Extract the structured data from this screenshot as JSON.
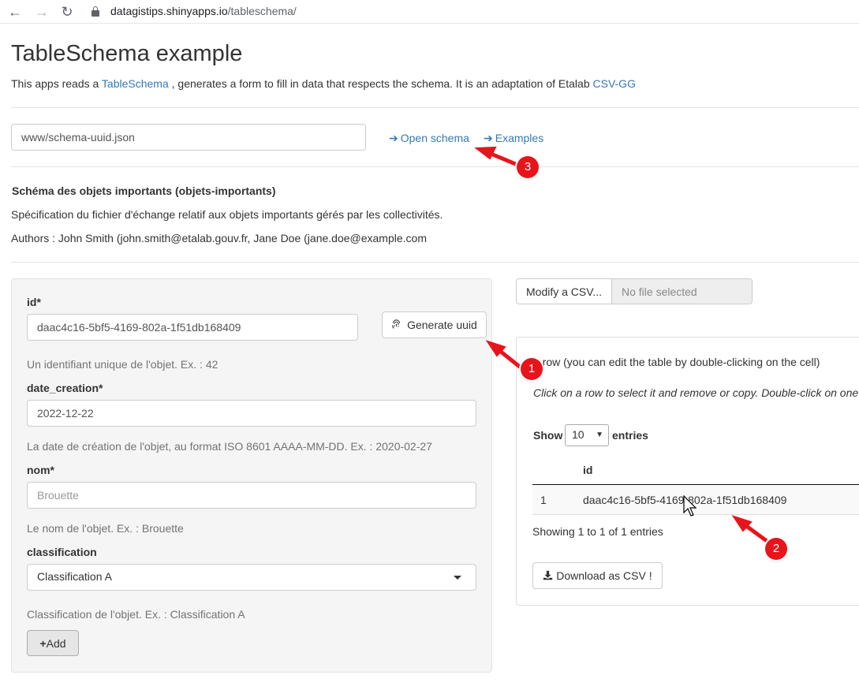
{
  "browser": {
    "url_host": "datagistips.shinyapps.io",
    "url_path": "/tableschema/"
  },
  "page": {
    "title": "TableSchema example",
    "intro_before": "This apps reads a ",
    "intro_link": "TableSchema",
    "intro_middle": " , generates a form to fill in data that respects the schema. It is an adaptation of Etalab ",
    "intro_link2": "CSV-GG"
  },
  "schema_picker": {
    "value": "www/schema-uuid.json",
    "open_label": "Open schema",
    "examples_label": "Examples"
  },
  "schema_info": {
    "title": "Schéma des objets importants (objets-importants)",
    "description": "Spécification du fichier d'échange relatif aux objets importants gérés par les collectivités.",
    "authors": "Authors : John Smith (john.smith@etalab.gouv.fr, Jane Doe (jane.doe@example.com"
  },
  "form": {
    "id_label": "id*",
    "id_value": "daac4c16-5bf5-4169-802a-1f51db168409",
    "generate_label": "Generate uuid",
    "id_help": "Un identifiant unique de l'objet. Ex. : 42",
    "date_label": "date_creation*",
    "date_value": "2022-12-22",
    "date_help": "La date de création de l'objet, au format ISO 8601 AAAA-MM-DD. Ex. : 2020-02-27",
    "nom_label": "nom*",
    "nom_placeholder": "Brouette",
    "nom_help": "Le nom de l'objet. Ex. : Brouette",
    "class_label": "classification",
    "class_value": "Classification A",
    "class_help": "Classification de l'objet. Ex. : Classification A",
    "add_label": "Add"
  },
  "file_input": {
    "button_label": "Modify a CSV...",
    "status": "No file selected"
  },
  "table_panel": {
    "row_count": "1",
    "row_info": " row (you can edit the table by double-clicking on the cell)",
    "instructions": "Click on a row to select it and remove or copy. Double-click on one",
    "show_label": "Show",
    "page_length": "10",
    "entries_label": "entries",
    "column_header": "id",
    "rows": [
      {
        "index": "1",
        "id": "daac4c16-5bf5-4169-802a-1f51db168409"
      }
    ],
    "footer": "Showing 1 to 1 of 1 entries",
    "download_label": "Download as CSV !"
  },
  "annotations": [
    "1",
    "2",
    "3"
  ],
  "colors": {
    "link": "#337ab7",
    "annotation": "#e8141c",
    "well_bg": "#f5f5f5"
  }
}
